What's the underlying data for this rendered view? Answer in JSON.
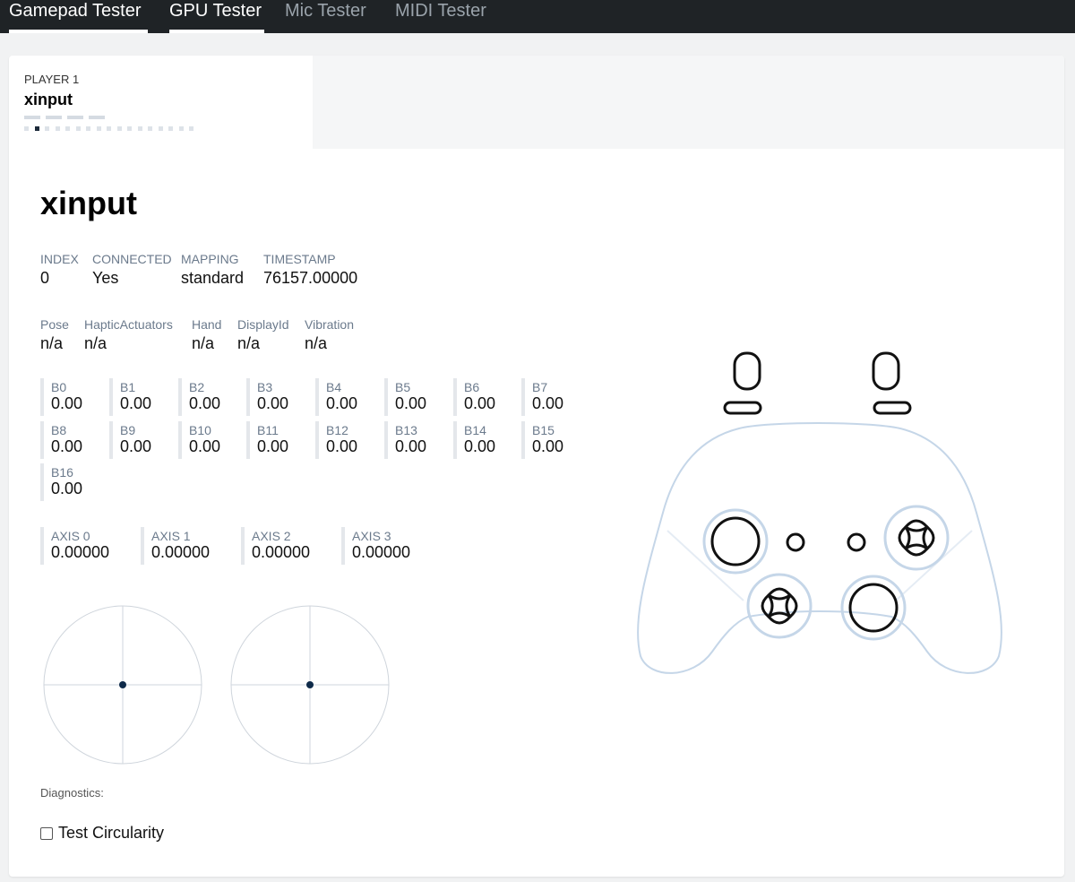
{
  "nav": {
    "tabs": [
      {
        "label": "Gamepad Tester",
        "active": true
      },
      {
        "label": "GPU Tester",
        "active": true
      },
      {
        "label": "Mic Tester",
        "active": false
      },
      {
        "label": "MIDI Tester",
        "active": false
      }
    ]
  },
  "player": {
    "label": "PLAYER 1",
    "name": "xinput"
  },
  "gamepad": {
    "title": "xinput",
    "info": [
      {
        "label": "INDEX",
        "value": "0"
      },
      {
        "label": "CONNECTED",
        "value": "Yes"
      },
      {
        "label": "MAPPING",
        "value": "standard"
      },
      {
        "label": "TIMESTAMP",
        "value": "76157.00000"
      }
    ],
    "extra": [
      {
        "label": "Pose",
        "value": "n/a"
      },
      {
        "label": "HapticActuators",
        "value": "n/a"
      },
      {
        "label": "Hand",
        "value": "n/a"
      },
      {
        "label": "DisplayId",
        "value": "n/a"
      },
      {
        "label": "Vibration",
        "value": "n/a"
      }
    ],
    "buttons": [
      {
        "label": "B0",
        "value": "0.00"
      },
      {
        "label": "B1",
        "value": "0.00"
      },
      {
        "label": "B2",
        "value": "0.00"
      },
      {
        "label": "B3",
        "value": "0.00"
      },
      {
        "label": "B4",
        "value": "0.00"
      },
      {
        "label": "B5",
        "value": "0.00"
      },
      {
        "label": "B6",
        "value": "0.00"
      },
      {
        "label": "B7",
        "value": "0.00"
      },
      {
        "label": "B8",
        "value": "0.00"
      },
      {
        "label": "B9",
        "value": "0.00"
      },
      {
        "label": "B10",
        "value": "0.00"
      },
      {
        "label": "B11",
        "value": "0.00"
      },
      {
        "label": "B12",
        "value": "0.00"
      },
      {
        "label": "B13",
        "value": "0.00"
      },
      {
        "label": "B14",
        "value": "0.00"
      },
      {
        "label": "B15",
        "value": "0.00"
      },
      {
        "label": "B16",
        "value": "0.00"
      }
    ],
    "axes": [
      {
        "label": "AXIS 0",
        "value": "0.00000"
      },
      {
        "label": "AXIS 1",
        "value": "0.00000"
      },
      {
        "label": "AXIS 2",
        "value": "0.00000"
      },
      {
        "label": "AXIS 3",
        "value": "0.00000"
      }
    ],
    "sticks": [
      {
        "x": 0,
        "y": 0
      },
      {
        "x": 0,
        "y": 0
      }
    ]
  },
  "diagnostics": {
    "label": "Diagnostics:",
    "test_circularity_label": "Test Circularity",
    "test_circularity_checked": false
  },
  "colors": {
    "nav_bg": "#1f2326",
    "controller_outline": "#c5d6e8",
    "stick_dot": "#0f2b4a"
  }
}
